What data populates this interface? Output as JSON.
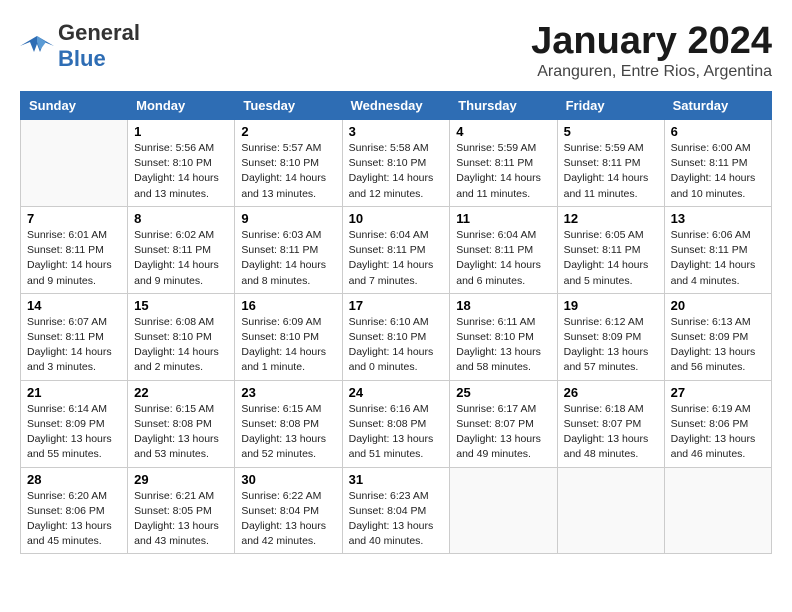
{
  "header": {
    "logo_general": "General",
    "logo_blue": "Blue",
    "month": "January 2024",
    "location": "Aranguren, Entre Rios, Argentina"
  },
  "weekdays": [
    "Sunday",
    "Monday",
    "Tuesday",
    "Wednesday",
    "Thursday",
    "Friday",
    "Saturday"
  ],
  "weeks": [
    [
      {
        "day": "",
        "info": ""
      },
      {
        "day": "1",
        "info": "Sunrise: 5:56 AM\nSunset: 8:10 PM\nDaylight: 14 hours\nand 13 minutes."
      },
      {
        "day": "2",
        "info": "Sunrise: 5:57 AM\nSunset: 8:10 PM\nDaylight: 14 hours\nand 13 minutes."
      },
      {
        "day": "3",
        "info": "Sunrise: 5:58 AM\nSunset: 8:10 PM\nDaylight: 14 hours\nand 12 minutes."
      },
      {
        "day": "4",
        "info": "Sunrise: 5:59 AM\nSunset: 8:11 PM\nDaylight: 14 hours\nand 11 minutes."
      },
      {
        "day": "5",
        "info": "Sunrise: 5:59 AM\nSunset: 8:11 PM\nDaylight: 14 hours\nand 11 minutes."
      },
      {
        "day": "6",
        "info": "Sunrise: 6:00 AM\nSunset: 8:11 PM\nDaylight: 14 hours\nand 10 minutes."
      }
    ],
    [
      {
        "day": "7",
        "info": "Sunrise: 6:01 AM\nSunset: 8:11 PM\nDaylight: 14 hours\nand 9 minutes."
      },
      {
        "day": "8",
        "info": "Sunrise: 6:02 AM\nSunset: 8:11 PM\nDaylight: 14 hours\nand 9 minutes."
      },
      {
        "day": "9",
        "info": "Sunrise: 6:03 AM\nSunset: 8:11 PM\nDaylight: 14 hours\nand 8 minutes."
      },
      {
        "day": "10",
        "info": "Sunrise: 6:04 AM\nSunset: 8:11 PM\nDaylight: 14 hours\nand 7 minutes."
      },
      {
        "day": "11",
        "info": "Sunrise: 6:04 AM\nSunset: 8:11 PM\nDaylight: 14 hours\nand 6 minutes."
      },
      {
        "day": "12",
        "info": "Sunrise: 6:05 AM\nSunset: 8:11 PM\nDaylight: 14 hours\nand 5 minutes."
      },
      {
        "day": "13",
        "info": "Sunrise: 6:06 AM\nSunset: 8:11 PM\nDaylight: 14 hours\nand 4 minutes."
      }
    ],
    [
      {
        "day": "14",
        "info": "Sunrise: 6:07 AM\nSunset: 8:11 PM\nDaylight: 14 hours\nand 3 minutes."
      },
      {
        "day": "15",
        "info": "Sunrise: 6:08 AM\nSunset: 8:10 PM\nDaylight: 14 hours\nand 2 minutes."
      },
      {
        "day": "16",
        "info": "Sunrise: 6:09 AM\nSunset: 8:10 PM\nDaylight: 14 hours\nand 1 minute."
      },
      {
        "day": "17",
        "info": "Sunrise: 6:10 AM\nSunset: 8:10 PM\nDaylight: 14 hours\nand 0 minutes."
      },
      {
        "day": "18",
        "info": "Sunrise: 6:11 AM\nSunset: 8:10 PM\nDaylight: 13 hours\nand 58 minutes."
      },
      {
        "day": "19",
        "info": "Sunrise: 6:12 AM\nSunset: 8:09 PM\nDaylight: 13 hours\nand 57 minutes."
      },
      {
        "day": "20",
        "info": "Sunrise: 6:13 AM\nSunset: 8:09 PM\nDaylight: 13 hours\nand 56 minutes."
      }
    ],
    [
      {
        "day": "21",
        "info": "Sunrise: 6:14 AM\nSunset: 8:09 PM\nDaylight: 13 hours\nand 55 minutes."
      },
      {
        "day": "22",
        "info": "Sunrise: 6:15 AM\nSunset: 8:08 PM\nDaylight: 13 hours\nand 53 minutes."
      },
      {
        "day": "23",
        "info": "Sunrise: 6:15 AM\nSunset: 8:08 PM\nDaylight: 13 hours\nand 52 minutes."
      },
      {
        "day": "24",
        "info": "Sunrise: 6:16 AM\nSunset: 8:08 PM\nDaylight: 13 hours\nand 51 minutes."
      },
      {
        "day": "25",
        "info": "Sunrise: 6:17 AM\nSunset: 8:07 PM\nDaylight: 13 hours\nand 49 minutes."
      },
      {
        "day": "26",
        "info": "Sunrise: 6:18 AM\nSunset: 8:07 PM\nDaylight: 13 hours\nand 48 minutes."
      },
      {
        "day": "27",
        "info": "Sunrise: 6:19 AM\nSunset: 8:06 PM\nDaylight: 13 hours\nand 46 minutes."
      }
    ],
    [
      {
        "day": "28",
        "info": "Sunrise: 6:20 AM\nSunset: 8:06 PM\nDaylight: 13 hours\nand 45 minutes."
      },
      {
        "day": "29",
        "info": "Sunrise: 6:21 AM\nSunset: 8:05 PM\nDaylight: 13 hours\nand 43 minutes."
      },
      {
        "day": "30",
        "info": "Sunrise: 6:22 AM\nSunset: 8:04 PM\nDaylight: 13 hours\nand 42 minutes."
      },
      {
        "day": "31",
        "info": "Sunrise: 6:23 AM\nSunset: 8:04 PM\nDaylight: 13 hours\nand 40 minutes."
      },
      {
        "day": "",
        "info": ""
      },
      {
        "day": "",
        "info": ""
      },
      {
        "day": "",
        "info": ""
      }
    ]
  ]
}
